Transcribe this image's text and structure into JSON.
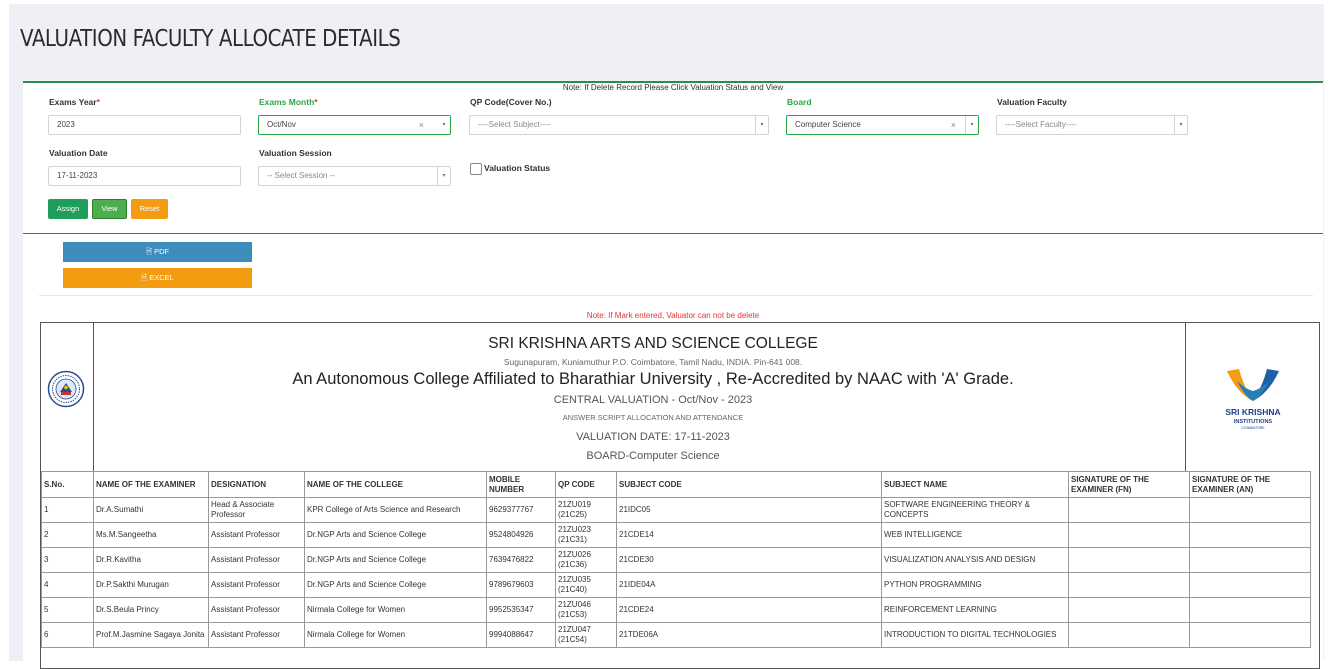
{
  "page_title": "VALUATION FACULTY ALLOCATE DETAILS",
  "note_top": "Note: If Delete Record Please Click Valuation Status and View",
  "form": {
    "exams_year": {
      "label": "Exams Year",
      "required_mark": "*",
      "value": "2023"
    },
    "exams_month": {
      "label": "Exams Month",
      "required_mark": "*",
      "value": "Oct/Nov",
      "clear": "×",
      "caret": "▾"
    },
    "qp_code": {
      "label": "QP Code(Cover No.)",
      "placeholder": "----Select Subject----",
      "caret": "▾"
    },
    "board": {
      "label": "Board",
      "value": "Computer Science",
      "clear": "×",
      "caret": "▾"
    },
    "valuation_faculty": {
      "label": "Valuation Faculty",
      "placeholder": "----Select Faculty----",
      "caret": "▾"
    },
    "valuation_date": {
      "label": "Valuation Date",
      "value": "17-11-2023"
    },
    "valuation_session": {
      "label": "Valuation Session",
      "placeholder": "-- Select Session --",
      "caret": "▾"
    },
    "valuation_status": {
      "label": "Valuation Status",
      "checked": false
    }
  },
  "buttons": {
    "assign": "Assign",
    "view": "View",
    "reset": "Reset",
    "pdf": "PDF",
    "excel": "EXCEL"
  },
  "note_mark": "Note: If Mark entered, Valuator can not be delete",
  "report": {
    "college_name": "SRI KRISHNA ARTS AND SCIENCE COLLEGE",
    "address": "Sugunapuram, Kuniamuthur P.O. Coimbatore, Tamil Nadu, INDIA. Pin-641 008.",
    "affiliation": "An Autonomous College Affiliated to Bharathiar University , Re-Accredited by NAAC with 'A' Grade.",
    "central_valuation": "CENTRAL VALUATION - Oct/Nov - 2023",
    "allocation_title": "ANSWER SCRIPT ALLOCATION AND ATTENDANCE",
    "valuation_date": "VALUATION DATE: 17-11-2023",
    "board": "BOARD-Computer Science",
    "logo_right_line1": "SRI KRISHNA",
    "logo_right_line2": "INSTITUTIONS",
    "logo_right_line3": "COIMBATORE",
    "logo_right_colors": [
      "#f39c12",
      "#1f5fa8"
    ],
    "columns": [
      "S.No.",
      "NAME OF THE EXAMINER",
      "DESIGNATION",
      "NAME OF THE COLLEGE",
      "MOBILE NUMBER",
      "QP CODE",
      "SUBJECT CODE",
      "SUBJECT NAME",
      "SIGNATURE OF THE EXAMINER (FN)",
      "SIGNATURE OF THE EXAMINER (AN)"
    ],
    "rows": [
      [
        "1",
        "Dr.A.Sumathi",
        "Head & Associate Professor",
        "KPR College of Arts Science and Research",
        "9629377767",
        "21ZU019 (21C25)",
        "21IDC05",
        "SOFTWARE ENGINEERING THEORY & CONCEPTS",
        "",
        ""
      ],
      [
        "2",
        "Ms.M.Sangeetha",
        "Assistant Professor",
        "Dr.NGP Arts and Science College",
        "9524804926",
        "21ZU023 (21C31)",
        "21CDE14",
        "WEB INTELLIGENCE",
        "",
        ""
      ],
      [
        "3",
        "Dr.R.Kavitha",
        "Assistant Professor",
        "Dr.NGP Arts and Science College",
        "7639476822",
        "21ZU026 (21C36)",
        "21CDE30",
        "VISUALIZATION ANALYSIS AND DESIGN",
        "",
        ""
      ],
      [
        "4",
        "Dr.P.Sakthi Murugan",
        "Assistant Professor",
        "Dr.NGP Arts and Science College",
        "9789679603",
        "21ZU035 (21C40)",
        "21IDE04A",
        "PYTHON PROGRAMMING",
        "",
        ""
      ],
      [
        "5",
        "Dr.S.Beula Princy",
        "Assistant Professor",
        "Nirmala College for Women",
        "9952535347",
        "21ZU046 (21C53)",
        "21CDE24",
        "REINFORCEMENT LEARNING",
        "",
        ""
      ],
      [
        "6",
        "Prof.M.Jasmine Sagaya Jonita",
        "Assistant Professor",
        "Nirmala College for Women",
        "9994088647",
        "21ZU047 (21C54)",
        "21TDE06A",
        "INTRODUCTION TO DIGITAL TECHNOLOGIES",
        "",
        ""
      ]
    ]
  }
}
